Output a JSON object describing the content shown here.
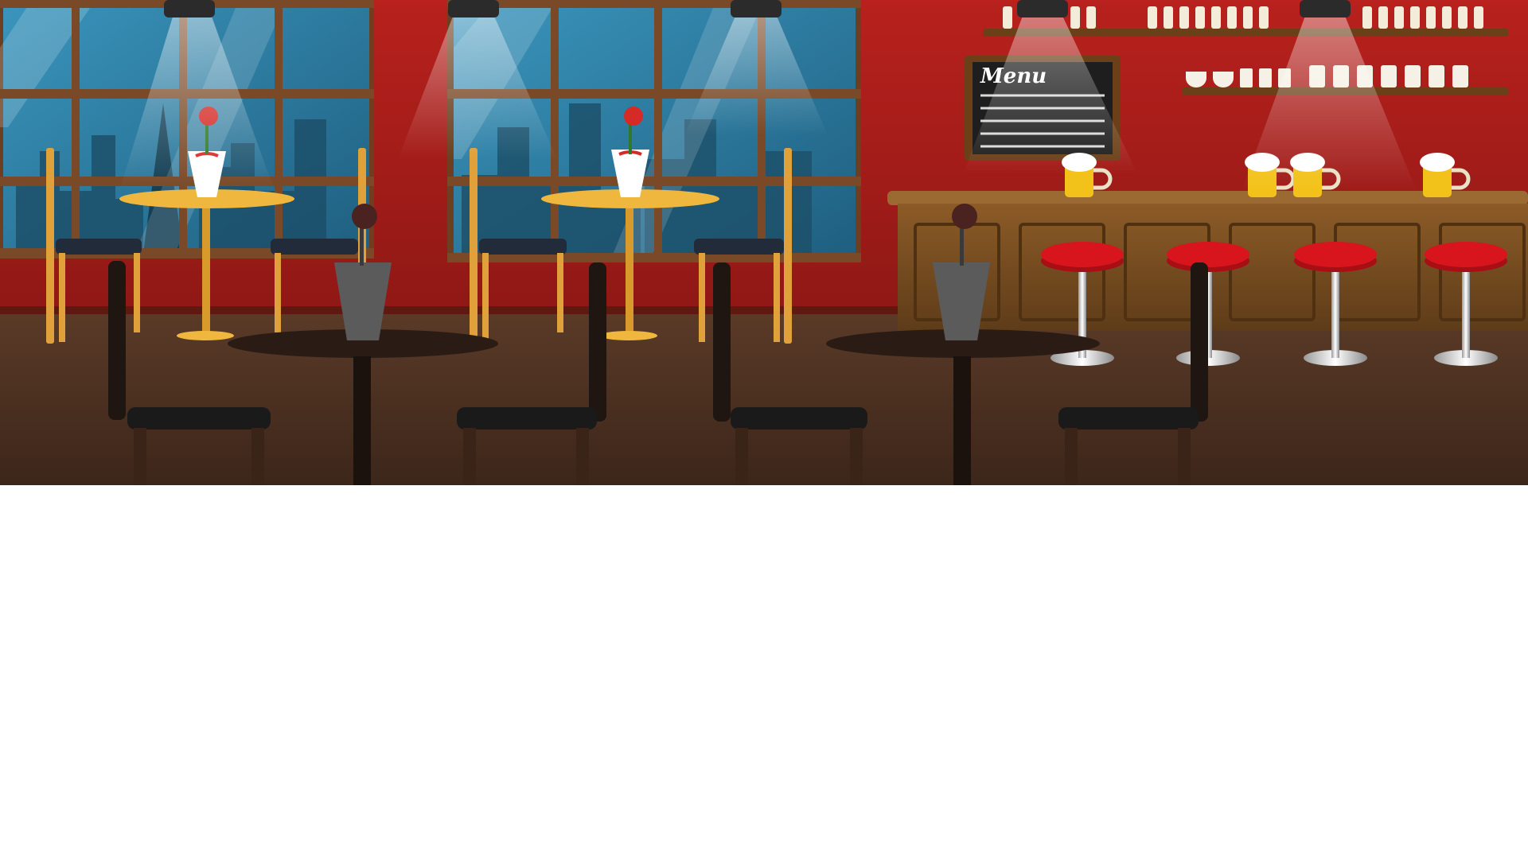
{
  "scene": {
    "menu_board": {
      "title": "Menu"
    },
    "colors": {
      "wall": "#b01f1c",
      "wall_dark": "#8a1613",
      "floor": "#4a3022",
      "window_frame": "#7a4a28",
      "window_glass": "#2e7fa3",
      "bar_wood": "#7b4f22",
      "stool_seat": "#d8141c",
      "beer": "#f3c21a",
      "foam": "#ffffff",
      "rose": "#d62a26",
      "back_chair": "#1f1612",
      "back_table": "#2a1c14",
      "table_gold": "#f0b73e"
    }
  }
}
